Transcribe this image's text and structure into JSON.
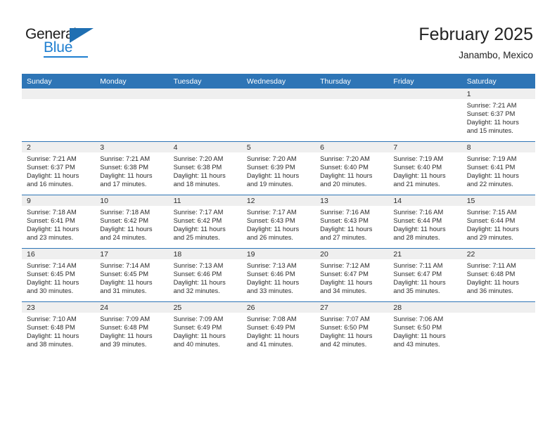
{
  "logo": {
    "word_top": "General",
    "word_bottom": "Blue",
    "triangle_color": "#1f6fb2",
    "blue_color": "#1f7fd0"
  },
  "header": {
    "title": "February 2025",
    "subtitle": "Janambo, Mexico"
  },
  "theme": {
    "header_blue": "#2e75b6",
    "daynum_band": "#efefef",
    "text": "#2b2b2b"
  },
  "weekdays": [
    "Sunday",
    "Monday",
    "Tuesday",
    "Wednesday",
    "Thursday",
    "Friday",
    "Saturday"
  ],
  "labels": {
    "sunrise": "Sunrise:",
    "sunset": "Sunset:",
    "daylight": "Daylight:"
  },
  "weeks": [
    [
      {
        "day": "",
        "empty": true
      },
      {
        "day": "",
        "empty": true
      },
      {
        "day": "",
        "empty": true
      },
      {
        "day": "",
        "empty": true
      },
      {
        "day": "",
        "empty": true
      },
      {
        "day": "",
        "empty": true
      },
      {
        "day": "1",
        "sunrise": "Sunrise: 7:21 AM",
        "sunset": "Sunset: 6:37 PM",
        "daylight": "Daylight: 11 hours and 15 minutes."
      }
    ],
    [
      {
        "day": "2",
        "sunrise": "Sunrise: 7:21 AM",
        "sunset": "Sunset: 6:37 PM",
        "daylight": "Daylight: 11 hours and 16 minutes."
      },
      {
        "day": "3",
        "sunrise": "Sunrise: 7:21 AM",
        "sunset": "Sunset: 6:38 PM",
        "daylight": "Daylight: 11 hours and 17 minutes."
      },
      {
        "day": "4",
        "sunrise": "Sunrise: 7:20 AM",
        "sunset": "Sunset: 6:38 PM",
        "daylight": "Daylight: 11 hours and 18 minutes."
      },
      {
        "day": "5",
        "sunrise": "Sunrise: 7:20 AM",
        "sunset": "Sunset: 6:39 PM",
        "daylight": "Daylight: 11 hours and 19 minutes."
      },
      {
        "day": "6",
        "sunrise": "Sunrise: 7:20 AM",
        "sunset": "Sunset: 6:40 PM",
        "daylight": "Daylight: 11 hours and 20 minutes."
      },
      {
        "day": "7",
        "sunrise": "Sunrise: 7:19 AM",
        "sunset": "Sunset: 6:40 PM",
        "daylight": "Daylight: 11 hours and 21 minutes."
      },
      {
        "day": "8",
        "sunrise": "Sunrise: 7:19 AM",
        "sunset": "Sunset: 6:41 PM",
        "daylight": "Daylight: 11 hours and 22 minutes."
      }
    ],
    [
      {
        "day": "9",
        "sunrise": "Sunrise: 7:18 AM",
        "sunset": "Sunset: 6:41 PM",
        "daylight": "Daylight: 11 hours and 23 minutes."
      },
      {
        "day": "10",
        "sunrise": "Sunrise: 7:18 AM",
        "sunset": "Sunset: 6:42 PM",
        "daylight": "Daylight: 11 hours and 24 minutes."
      },
      {
        "day": "11",
        "sunrise": "Sunrise: 7:17 AM",
        "sunset": "Sunset: 6:42 PM",
        "daylight": "Daylight: 11 hours and 25 minutes."
      },
      {
        "day": "12",
        "sunrise": "Sunrise: 7:17 AM",
        "sunset": "Sunset: 6:43 PM",
        "daylight": "Daylight: 11 hours and 26 minutes."
      },
      {
        "day": "13",
        "sunrise": "Sunrise: 7:16 AM",
        "sunset": "Sunset: 6:43 PM",
        "daylight": "Daylight: 11 hours and 27 minutes."
      },
      {
        "day": "14",
        "sunrise": "Sunrise: 7:16 AM",
        "sunset": "Sunset: 6:44 PM",
        "daylight": "Daylight: 11 hours and 28 minutes."
      },
      {
        "day": "15",
        "sunrise": "Sunrise: 7:15 AM",
        "sunset": "Sunset: 6:44 PM",
        "daylight": "Daylight: 11 hours and 29 minutes."
      }
    ],
    [
      {
        "day": "16",
        "sunrise": "Sunrise: 7:14 AM",
        "sunset": "Sunset: 6:45 PM",
        "daylight": "Daylight: 11 hours and 30 minutes."
      },
      {
        "day": "17",
        "sunrise": "Sunrise: 7:14 AM",
        "sunset": "Sunset: 6:45 PM",
        "daylight": "Daylight: 11 hours and 31 minutes."
      },
      {
        "day": "18",
        "sunrise": "Sunrise: 7:13 AM",
        "sunset": "Sunset: 6:46 PM",
        "daylight": "Daylight: 11 hours and 32 minutes."
      },
      {
        "day": "19",
        "sunrise": "Sunrise: 7:13 AM",
        "sunset": "Sunset: 6:46 PM",
        "daylight": "Daylight: 11 hours and 33 minutes."
      },
      {
        "day": "20",
        "sunrise": "Sunrise: 7:12 AM",
        "sunset": "Sunset: 6:47 PM",
        "daylight": "Daylight: 11 hours and 34 minutes."
      },
      {
        "day": "21",
        "sunrise": "Sunrise: 7:11 AM",
        "sunset": "Sunset: 6:47 PM",
        "daylight": "Daylight: 11 hours and 35 minutes."
      },
      {
        "day": "22",
        "sunrise": "Sunrise: 7:11 AM",
        "sunset": "Sunset: 6:48 PM",
        "daylight": "Daylight: 11 hours and 36 minutes."
      }
    ],
    [
      {
        "day": "23",
        "sunrise": "Sunrise: 7:10 AM",
        "sunset": "Sunset: 6:48 PM",
        "daylight": "Daylight: 11 hours and 38 minutes."
      },
      {
        "day": "24",
        "sunrise": "Sunrise: 7:09 AM",
        "sunset": "Sunset: 6:48 PM",
        "daylight": "Daylight: 11 hours and 39 minutes."
      },
      {
        "day": "25",
        "sunrise": "Sunrise: 7:09 AM",
        "sunset": "Sunset: 6:49 PM",
        "daylight": "Daylight: 11 hours and 40 minutes."
      },
      {
        "day": "26",
        "sunrise": "Sunrise: 7:08 AM",
        "sunset": "Sunset: 6:49 PM",
        "daylight": "Daylight: 11 hours and 41 minutes."
      },
      {
        "day": "27",
        "sunrise": "Sunrise: 7:07 AM",
        "sunset": "Sunset: 6:50 PM",
        "daylight": "Daylight: 11 hours and 42 minutes."
      },
      {
        "day": "28",
        "sunrise": "Sunrise: 7:06 AM",
        "sunset": "Sunset: 6:50 PM",
        "daylight": "Daylight: 11 hours and 43 minutes."
      },
      {
        "day": "",
        "empty": true
      }
    ]
  ]
}
